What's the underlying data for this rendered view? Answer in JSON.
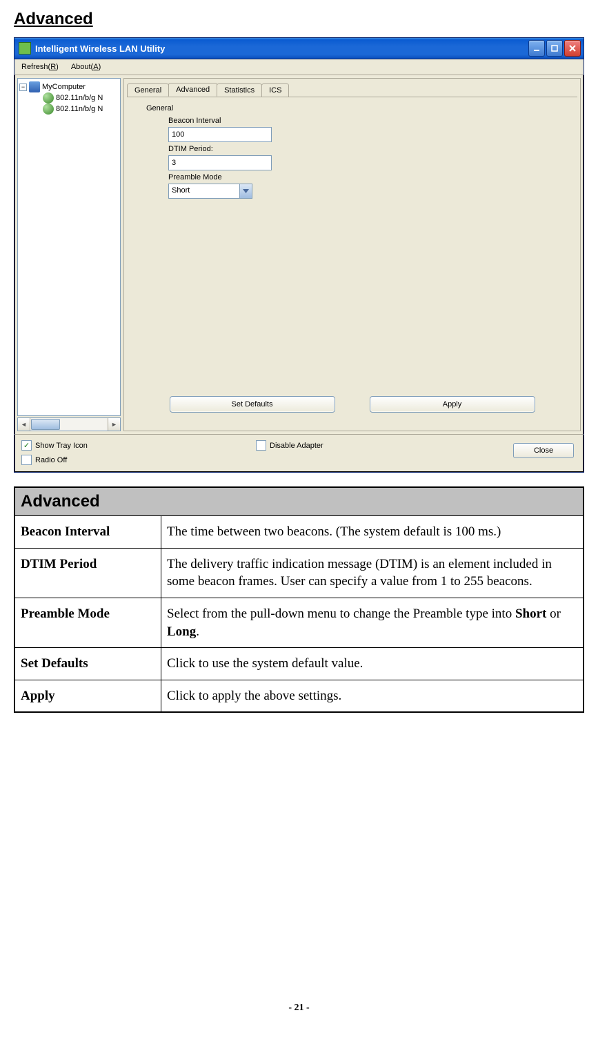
{
  "page_heading": "Advanced",
  "window": {
    "title": "Intelligent Wireless LAN Utility",
    "menubar": {
      "refresh": "Refresh(R)",
      "about": "About(A)"
    },
    "tree": {
      "root": "MyComputer",
      "items": [
        "802.11n/b/g N",
        "802.11n/b/g N"
      ]
    },
    "tabs": {
      "general": "General",
      "advanced": "Advanced",
      "statistics": "Statistics",
      "ics": "ICS"
    },
    "form": {
      "group_label": "General",
      "beacon_label": "Beacon Interval",
      "beacon_value": "100",
      "dtim_label": "DTIM Period:",
      "dtim_value": "3",
      "preamble_label": "Preamble Mode",
      "preamble_value": "Short"
    },
    "buttons": {
      "set_defaults": "Set Defaults",
      "apply": "Apply"
    },
    "bottom": {
      "show_tray": "Show Tray Icon",
      "radio_off": "Radio Off",
      "disable_adapter": "Disable Adapter",
      "close": "Close"
    }
  },
  "table": {
    "header": "Advanced",
    "rows": [
      {
        "key": "Beacon Interval",
        "desc": "The time between two beacons. (The system default is 100 ms.)"
      },
      {
        "key": "DTIM Period",
        "desc": "The delivery traffic indication message (DTIM) is an element included in some beacon frames. User can specify a value from 1 to 255 beacons."
      },
      {
        "key": "Preamble Mode",
        "desc_html": "Select from the pull-down menu to change the Preamble type into <b>Short</b> or <b>Long</b>."
      },
      {
        "key": "Set Defaults",
        "desc": "Click to use the system default value."
      },
      {
        "key": "Apply",
        "desc": "Click to apply the above settings."
      }
    ]
  },
  "footer": "- 21 -"
}
